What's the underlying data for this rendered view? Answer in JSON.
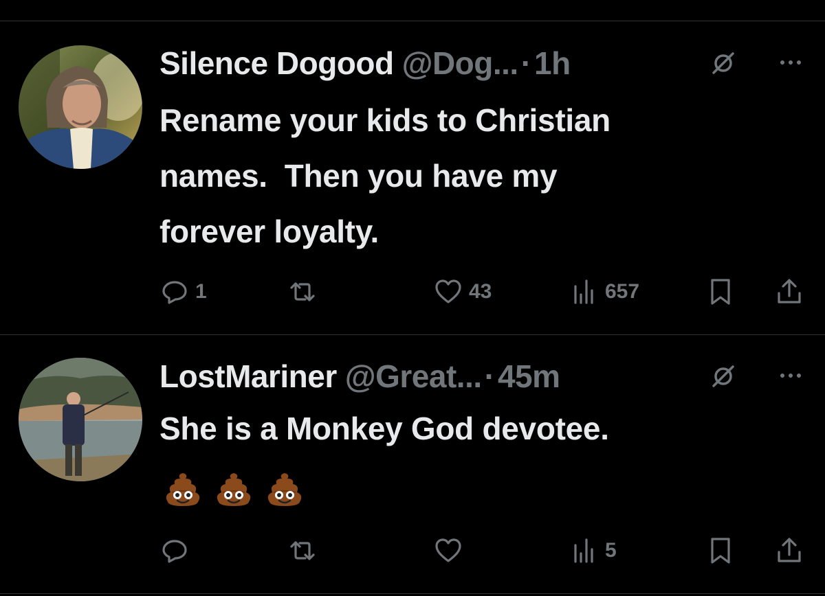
{
  "tweets": [
    {
      "name": "Silence Dogood",
      "handle": "@Dog...",
      "separator": "·",
      "time": "1h",
      "text": "Rename your kids to Christian\nnames.  Then you have my\nforever loyalty.",
      "emojis": [],
      "reply_count": "1",
      "retweet_count": "",
      "like_count": "43",
      "view_count": "657"
    },
    {
      "name": "LostMariner",
      "handle": "@Great...",
      "separator": "·",
      "time": "45m",
      "text": "She is a Monkey God devotee.",
      "emojis": [
        "pile-of-poo",
        "pile-of-poo",
        "pile-of-poo"
      ],
      "reply_count": "",
      "retweet_count": "",
      "like_count": "",
      "view_count": "5"
    }
  ],
  "icons": {
    "reply": "reply-icon",
    "retweet": "retweet-icon",
    "like": "heart-icon",
    "views": "views-icon",
    "bookmark": "bookmark-icon",
    "share": "share-icon",
    "grok": "grok-icon",
    "more": "more-icon"
  },
  "colors": {
    "background": "#000000",
    "text_primary": "#e7e9ea",
    "text_secondary": "#71767b",
    "divider": "#2f3336"
  }
}
